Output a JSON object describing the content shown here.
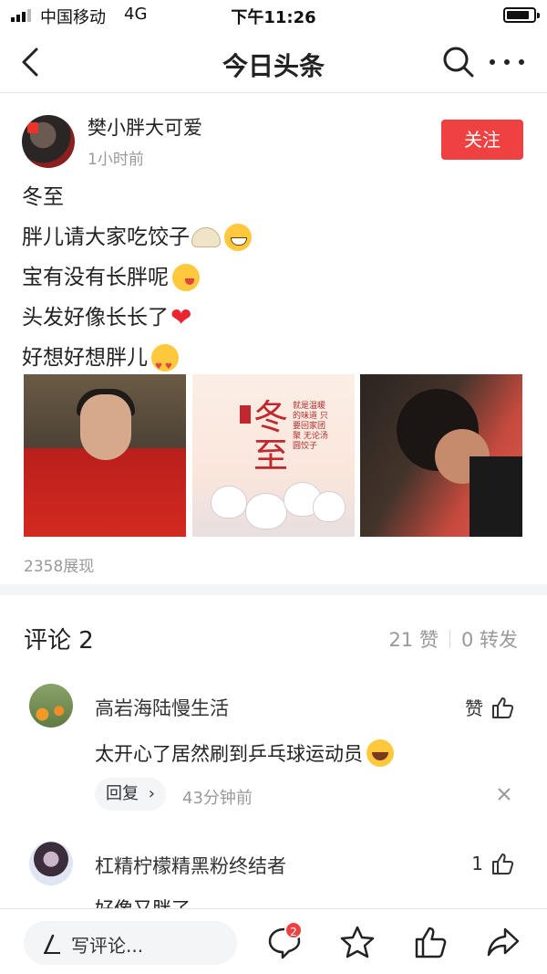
{
  "status_bar": {
    "carrier": "中国移动",
    "network": "4G",
    "time": "下午11:26"
  },
  "nav": {
    "title": "今日头条"
  },
  "post": {
    "author": "樊小胖大可爱",
    "time": "1小时前",
    "follow_label": "关注",
    "lines": [
      "冬至",
      "胖儿请大家吃饺子",
      "宝有没有长胖呢",
      "头发好像长长了",
      "好想好想胖儿"
    ],
    "images": [
      {
        "text": ""
      },
      {
        "title": "冬至",
        "verse": "就是温暖的味道 只要回家团聚 无论汤圆饺子"
      },
      {
        "text": ""
      }
    ],
    "views": "2358展现"
  },
  "comments_section": {
    "title": "评论 2",
    "likes": "21 赞",
    "shares": "0 转发",
    "comments": [
      {
        "name": "高岩海陆慢生活",
        "like_label": "赞",
        "text": "太开心了居然刷到乒乓球运动员",
        "reply_label": "回复",
        "reply_time": "43分钟前"
      },
      {
        "name": "杠精柠檬精黑粉终结者",
        "like_label": "1",
        "text": "好像又胖了"
      }
    ]
  },
  "bottom_bar": {
    "write_placeholder": "写评论...",
    "comment_count_badge": "2"
  },
  "colors": {
    "accent": "#f04142",
    "text": "#222222",
    "muted": "#999999"
  },
  "icons": [
    "back-icon",
    "search-icon",
    "more-icon",
    "like-icon",
    "close-icon",
    "pen-icon",
    "comment-icon",
    "star-icon",
    "share-icon"
  ]
}
